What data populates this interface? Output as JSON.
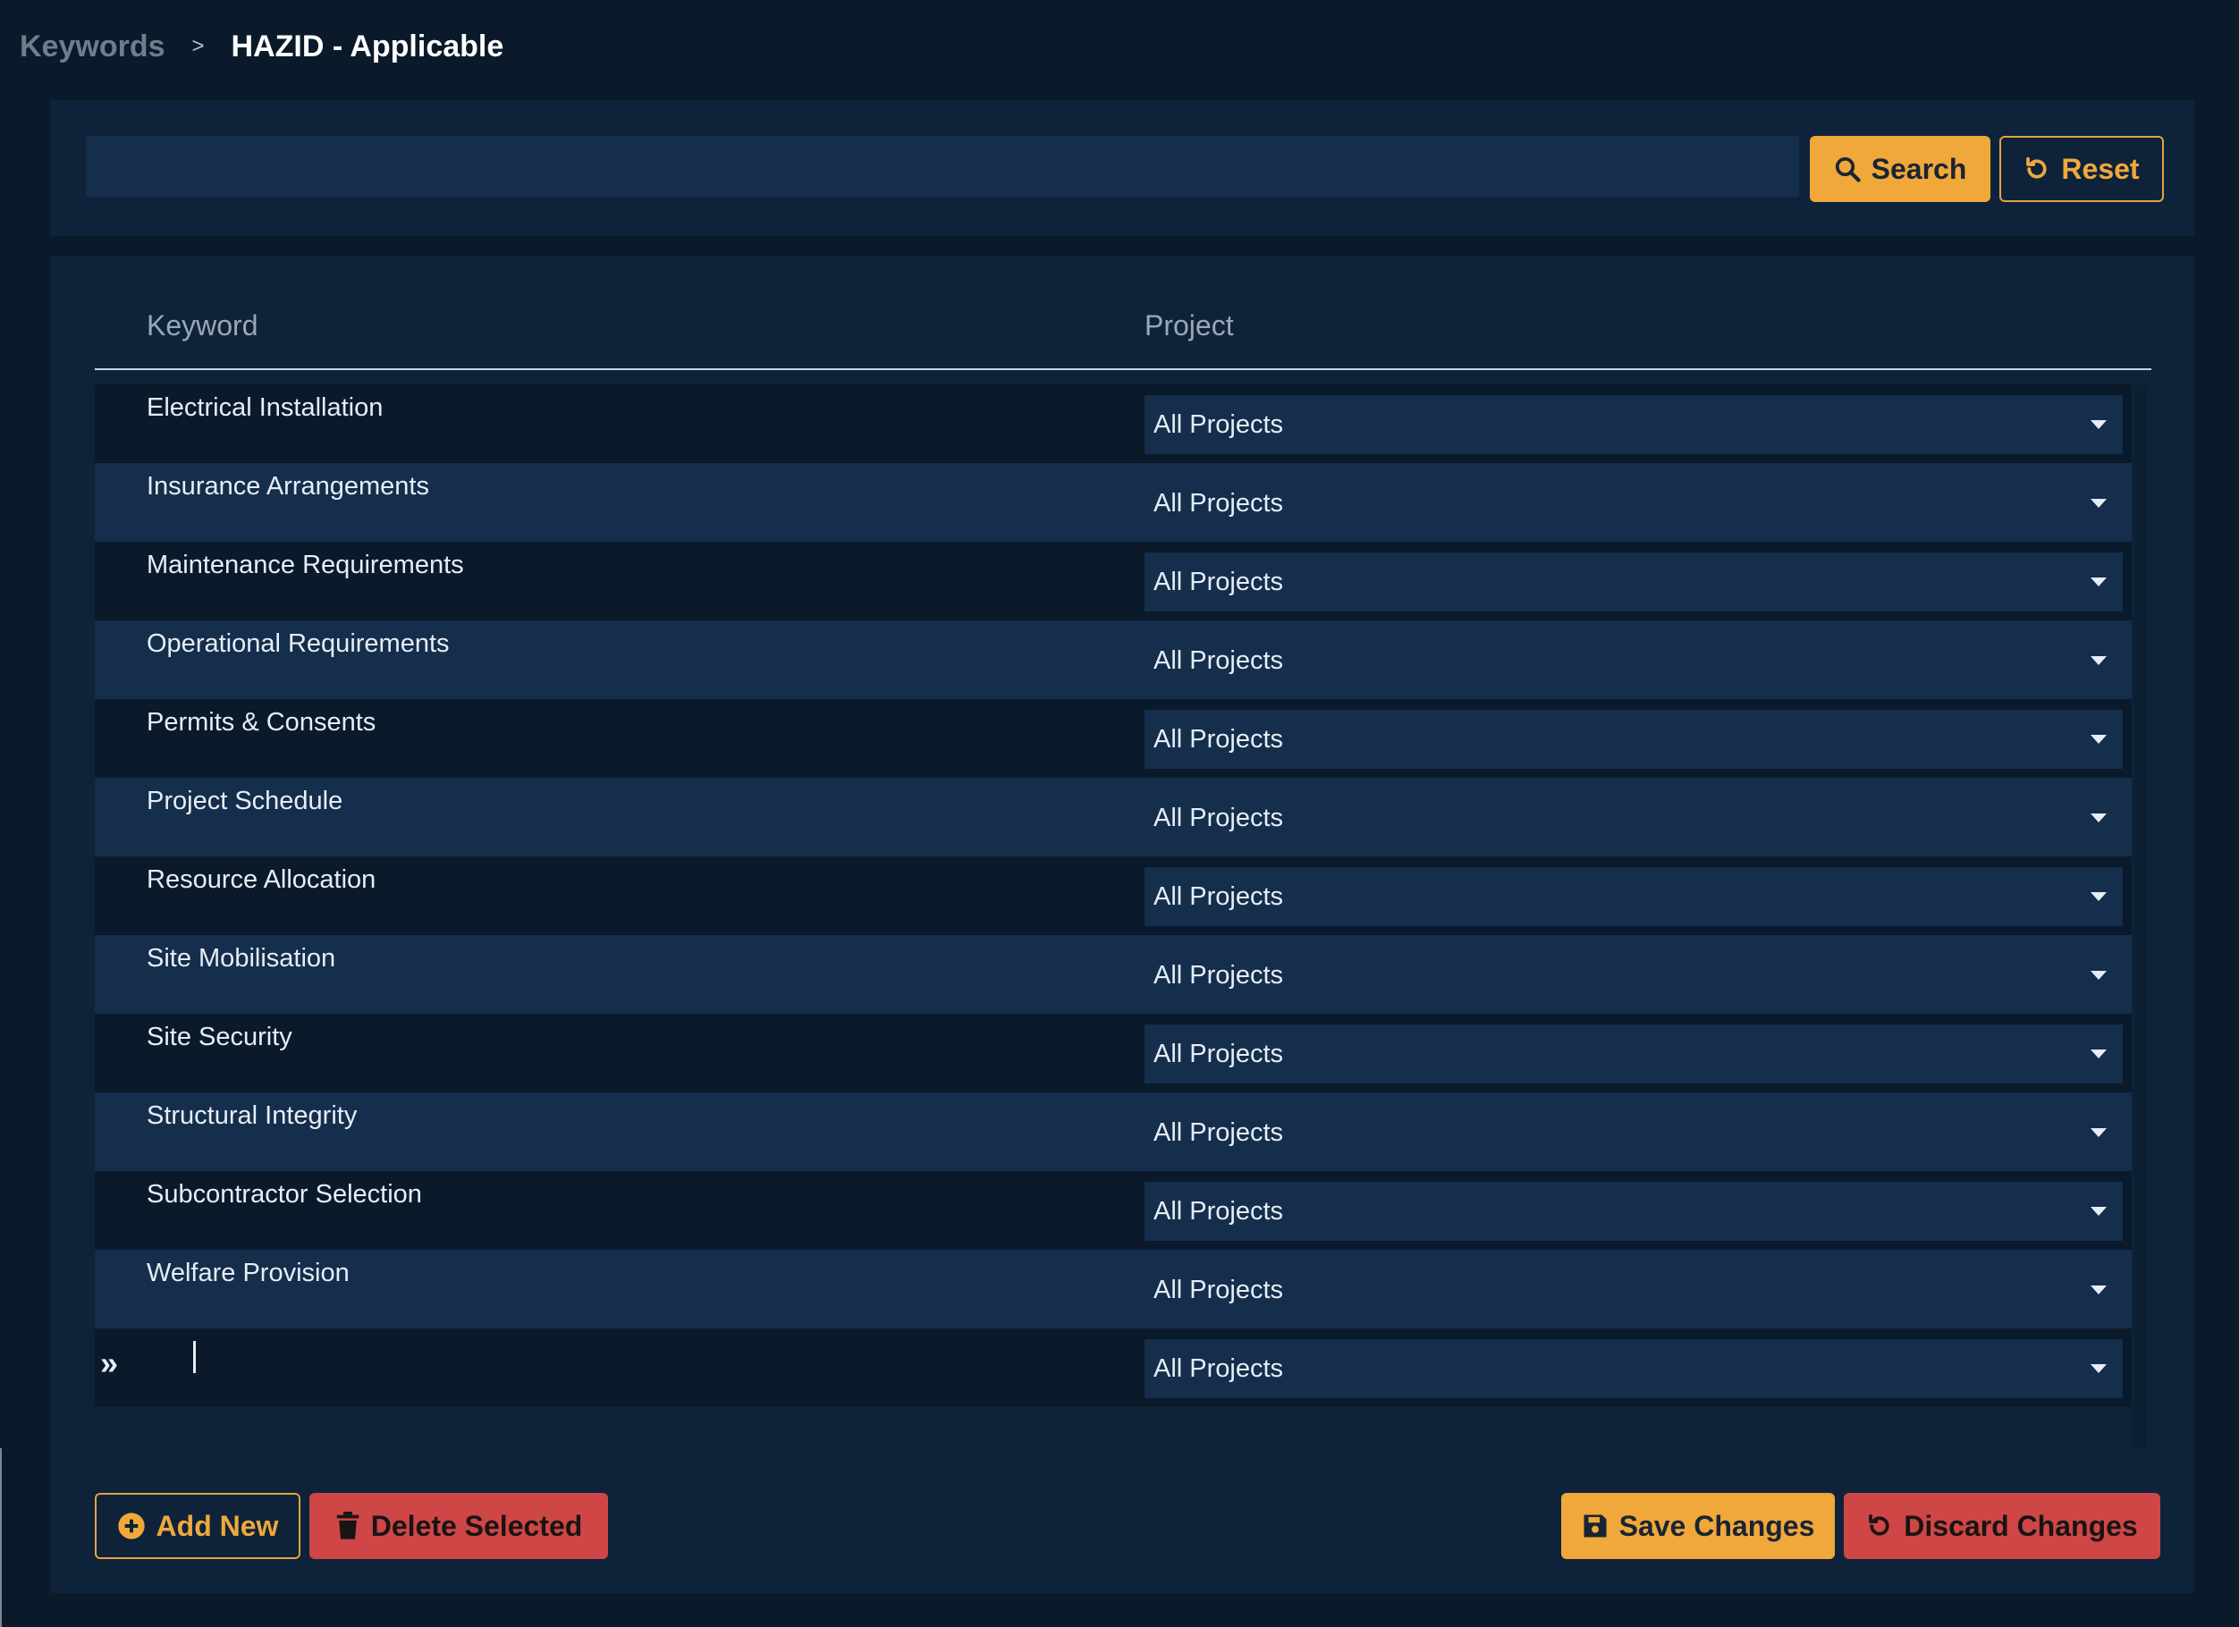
{
  "breadcrumb": {
    "root": "Keywords",
    "separator": ">",
    "current": "HAZID - Applicable"
  },
  "search": {
    "value": "",
    "placeholder": "",
    "search_label": "Search",
    "reset_label": "Reset"
  },
  "table": {
    "columns": {
      "keyword": "Keyword",
      "project": "Project"
    },
    "rows": [
      {
        "keyword": "Electrical Installation",
        "project": "All Projects"
      },
      {
        "keyword": "Insurance Arrangements",
        "project": "All Projects"
      },
      {
        "keyword": "Maintenance Requirements",
        "project": "All Projects"
      },
      {
        "keyword": "Operational Requirements",
        "project": "All Projects"
      },
      {
        "keyword": "Permits & Consents",
        "project": "All Projects"
      },
      {
        "keyword": "Project Schedule",
        "project": "All Projects"
      },
      {
        "keyword": "Resource Allocation",
        "project": "All Projects"
      },
      {
        "keyword": "Site Mobilisation",
        "project": "All Projects"
      },
      {
        "keyword": "Site Security",
        "project": "All Projects"
      },
      {
        "keyword": "Structural Integrity",
        "project": "All Projects"
      },
      {
        "keyword": "Subcontractor Selection",
        "project": "All Projects"
      },
      {
        "keyword": "Welfare Provision",
        "project": "All Projects"
      }
    ],
    "new_row": {
      "keyword": "",
      "project": "All Projects",
      "marker": "»"
    }
  },
  "actions": {
    "add_label": "Add New",
    "delete_label": "Delete Selected",
    "save_label": "Save Changes",
    "discard_label": "Discard Changes"
  },
  "colors": {
    "accent": "#f0a83a",
    "danger": "#cf4646",
    "background": "#0a1a2b",
    "panel": "#0e233a"
  }
}
